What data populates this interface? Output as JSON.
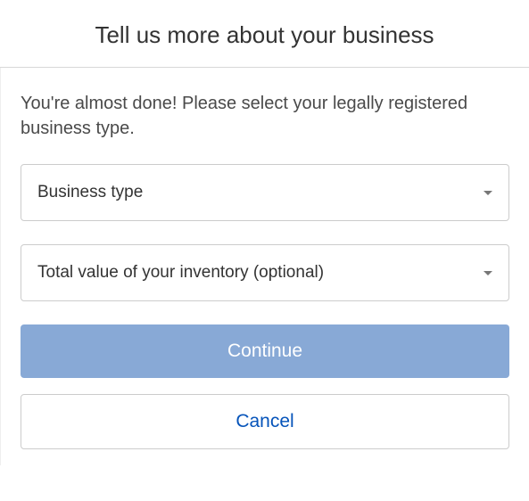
{
  "header": {
    "title": "Tell us more about your business"
  },
  "body": {
    "intro": "You're almost done! Please select your legally registered business type."
  },
  "dropdowns": {
    "business_type": {
      "label": "Business type"
    },
    "inventory_value": {
      "label": "Total value of your inventory (optional)"
    }
  },
  "buttons": {
    "continue": "Continue",
    "cancel": "Cancel"
  }
}
